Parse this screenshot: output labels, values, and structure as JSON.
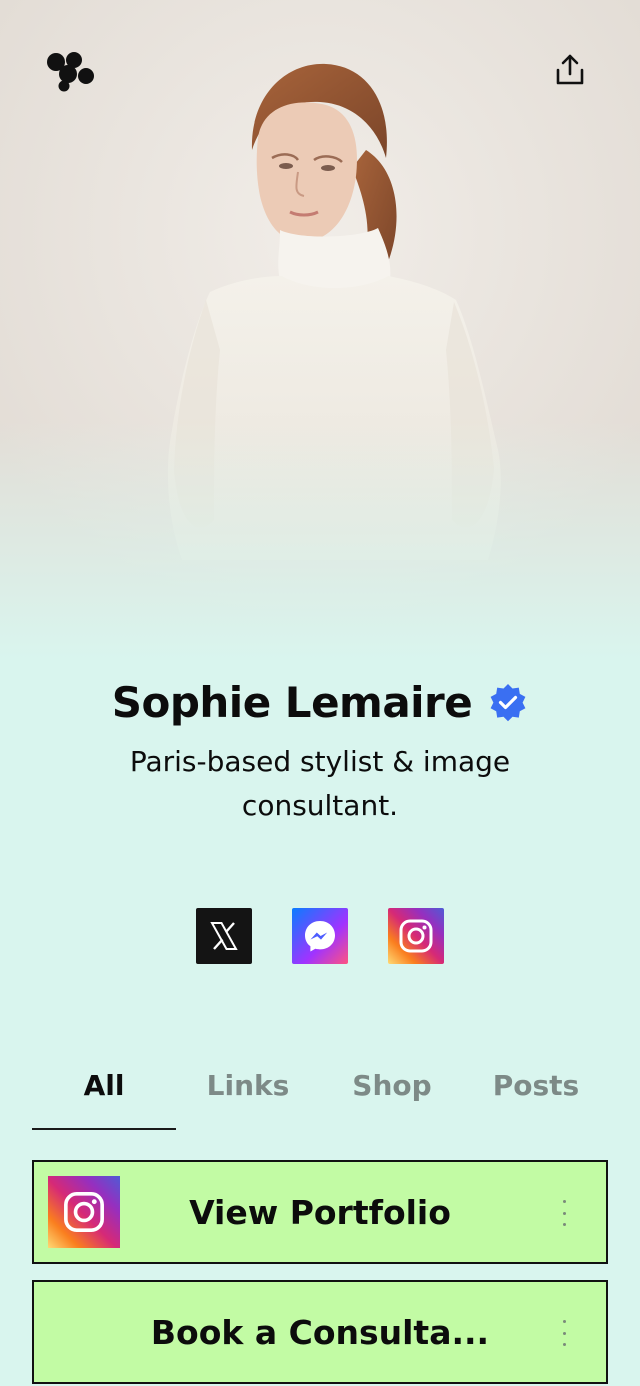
{
  "icons": {
    "logo": "linktree-blob-logo-icon",
    "share": "share-upload-icon",
    "verified": "verified-badge-icon",
    "more": "vertical-ellipsis-icon"
  },
  "profile": {
    "name": "Sophie Lemaire",
    "bio": "Paris-based stylist & image consultant."
  },
  "socials": [
    {
      "name": "x-icon",
      "color": "#141414"
    },
    {
      "name": "messenger-icon",
      "color": "#0a7cff"
    },
    {
      "name": "instagram-icon",
      "color": "#d62976"
    }
  ],
  "tabs": [
    {
      "label": "All",
      "active": true
    },
    {
      "label": "Links",
      "active": false
    },
    {
      "label": "Shop",
      "active": false
    },
    {
      "label": "Posts",
      "active": false
    }
  ],
  "links": [
    {
      "label": "View Portfolio",
      "thumbnail": "instagram-icon"
    },
    {
      "label": "Book a Consulta..."
    }
  ],
  "colors": {
    "background": "#d9f5ee",
    "card": "#c2fba4",
    "verified": "#3a6ff2",
    "text": "#0c0c0c",
    "tab_inactive": "#7d8a87"
  }
}
